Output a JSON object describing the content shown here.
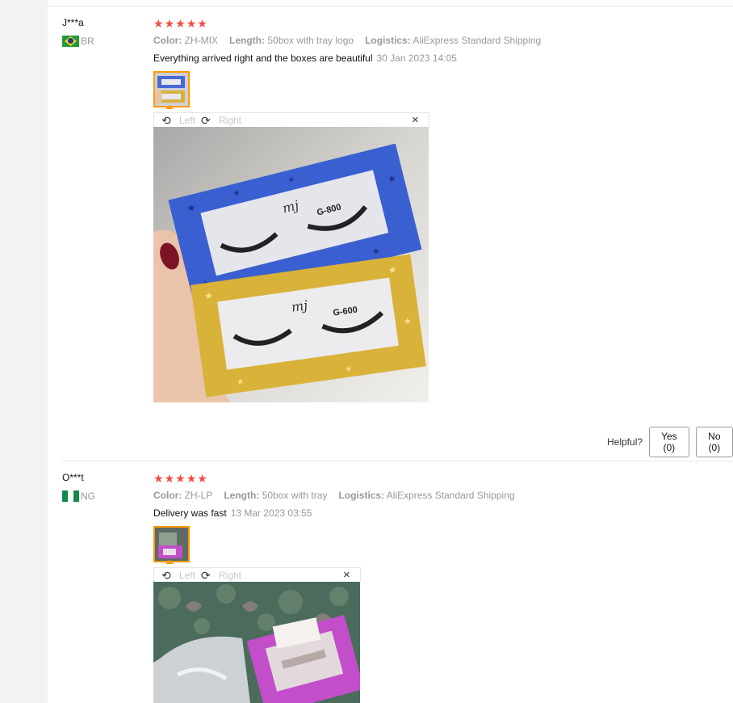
{
  "reviews": [
    {
      "user": "J***a",
      "country": "BR",
      "rating": 5,
      "labels": {
        "color": "Color:",
        "length": "Length:",
        "logistics": "Logistics:"
      },
      "color": "ZH-MIX",
      "length": "50box with tray logo",
      "logistics": "AliExpress Standard Shipping",
      "text": "Everything arrived right and the boxes are beautiful",
      "date": "30 Jan 2023 14:05",
      "viewer": {
        "left": "Left",
        "right": "Right"
      }
    },
    {
      "user": "O***t",
      "country": "NG",
      "rating": 5,
      "labels": {
        "color": "Color:",
        "length": "Length:",
        "logistics": "Logistics:"
      },
      "color": "ZH-LP",
      "length": "50box with tray",
      "logistics": "AliExpress Standard Shipping",
      "text": "Delivery was fast",
      "date": "13 Mar 2023 03:55",
      "viewer": {
        "left": "Left",
        "right": "Right"
      }
    }
  ],
  "helpful": {
    "question": "Helpful?",
    "yes": "Yes (0)",
    "no": "No (0)"
  },
  "photo_texts": {
    "brand": "mj",
    "top_model": "G-800",
    "bottom_model": "G-600"
  },
  "colors": {
    "star": "#f44b41",
    "thumb_border": "#ff9900",
    "blue_box": "#3a5fd0",
    "gold_box": "#d9b23a",
    "pink_box": "#c24fc9"
  }
}
